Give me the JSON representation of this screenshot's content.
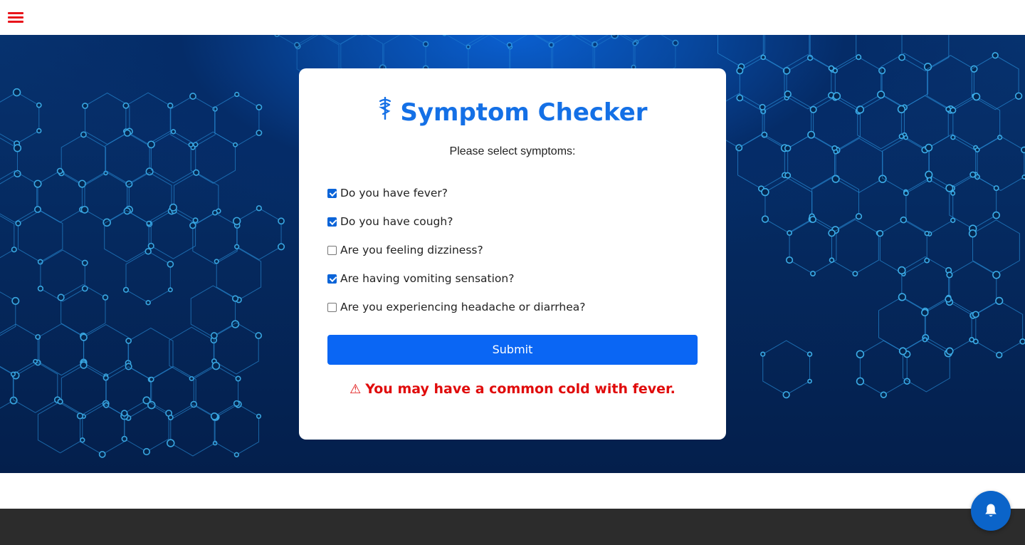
{
  "header": {
    "menu_icon": "hamburger-menu-icon",
    "menu_color": "#e8141b"
  },
  "hero": {
    "background_color": "#052c68",
    "pattern": "hexagon-molecule-network"
  },
  "card": {
    "icon": "caduceus-icon",
    "title": "Symptom Checker",
    "subtitle": "Please select symptoms:",
    "symptoms": [
      {
        "label": "Do you have fever?",
        "checked": true
      },
      {
        "label": "Do you have cough?",
        "checked": true
      },
      {
        "label": "Are you feeling dizziness?",
        "checked": false
      },
      {
        "label": "Are having vomiting sensation?",
        "checked": true
      },
      {
        "label": "Are you experiencing headache or diarrhea?",
        "checked": false
      }
    ],
    "submit_label": "Submit",
    "result_icon": "⚠",
    "result_text": "You may have a common cold with fever.",
    "accent_color": "#1470e6",
    "result_color": "#e00b0b"
  },
  "notification": {
    "icon": "bell-icon",
    "color": "#0b64c9"
  },
  "footer": {
    "color": "#2c2c2c"
  }
}
